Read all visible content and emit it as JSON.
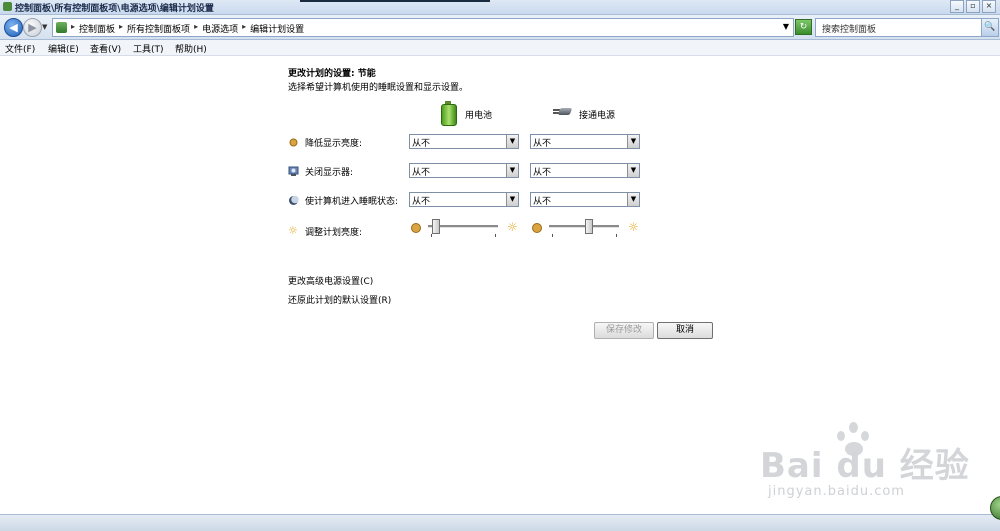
{
  "window": {
    "title": "控制面板\\所有控制面板项\\电源选项\\编辑计划设置",
    "buttons": [
      "_",
      "▫",
      "×"
    ]
  },
  "nav": {
    "back_glyph": "◀",
    "forward_glyph": "▶",
    "dropdown_glyph": "▼",
    "breadcrumbs": [
      "控制面板",
      "所有控制面板项",
      "电源选项",
      "编辑计划设置"
    ],
    "breadcrumb_sep": "▸",
    "refresh_glyph": "↻",
    "search_placeholder": "搜索控制面板",
    "search_icon": "🔍"
  },
  "menu": [
    "文件(F)",
    "编辑(E)",
    "查看(V)",
    "工具(T)",
    "帮助(H)"
  ],
  "page": {
    "title": "更改计划的设置: 节能",
    "subtitle": "选择希望计算机使用的睡眠设置和显示设置。",
    "col_battery": "用电池",
    "col_plugged": "接通电源",
    "rows": [
      {
        "label": "降低显示亮度:",
        "icon": "dim-display-icon",
        "battery": "从不",
        "plugged": "从不"
      },
      {
        "label": "关闭显示器:",
        "icon": "monitor-icon",
        "battery": "从不",
        "plugged": "从不"
      },
      {
        "label": "使计算机进入睡眠状态:",
        "icon": "sleep-moon-icon",
        "battery": "从不",
        "plugged": "从不"
      }
    ],
    "brightness_label": "调整计划亮度:",
    "brightness_battery": 0.1,
    "brightness_plugged": 0.55,
    "link_advanced": "更改高级电源设置(C)",
    "link_restore": "还原此计划的默认设置(R)",
    "save_label": "保存修改",
    "cancel_label": "取消"
  },
  "watermark": {
    "brand": "Bai du 经验",
    "url": "jingyan.baidu.com"
  }
}
